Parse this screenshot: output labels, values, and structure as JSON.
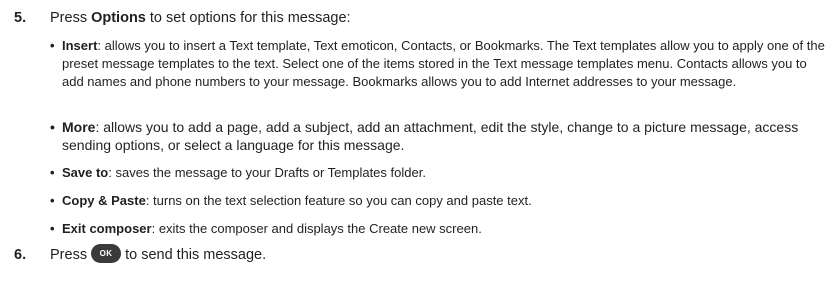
{
  "step5": {
    "number": "5.",
    "prefix": "Press ",
    "keyword": "Options",
    "suffix": " to set options for this message:"
  },
  "bullets": [
    {
      "term": "Insert",
      "text": ": allows you to insert a Text template, Text emoticon, Contacts, or Bookmarks. The Text templates allow you to apply one of the preset message templates to the text. Select one of the items stored in the Text message templates menu. Contacts allows you to add names and phone numbers to your message. Bookmarks allows you to add Internet addresses to your message."
    },
    {
      "term": "More",
      "text": ": allows you to add a page, add a subject, add an attachment, edit the style, change to a picture message, access sending options, or select a language for this message."
    },
    {
      "term": "Save to",
      "text": ": saves the message to your Drafts or Templates folder."
    },
    {
      "term": "Copy & Paste",
      "text": ": turns on the text selection feature so you can copy and paste text."
    },
    {
      "term": "Exit composer",
      "text": ": exits the composer and displays the Create new screen."
    }
  ],
  "step6": {
    "number": "6.",
    "prefix": "Press",
    "key_label": "OK",
    "suffix": "to send this message."
  }
}
